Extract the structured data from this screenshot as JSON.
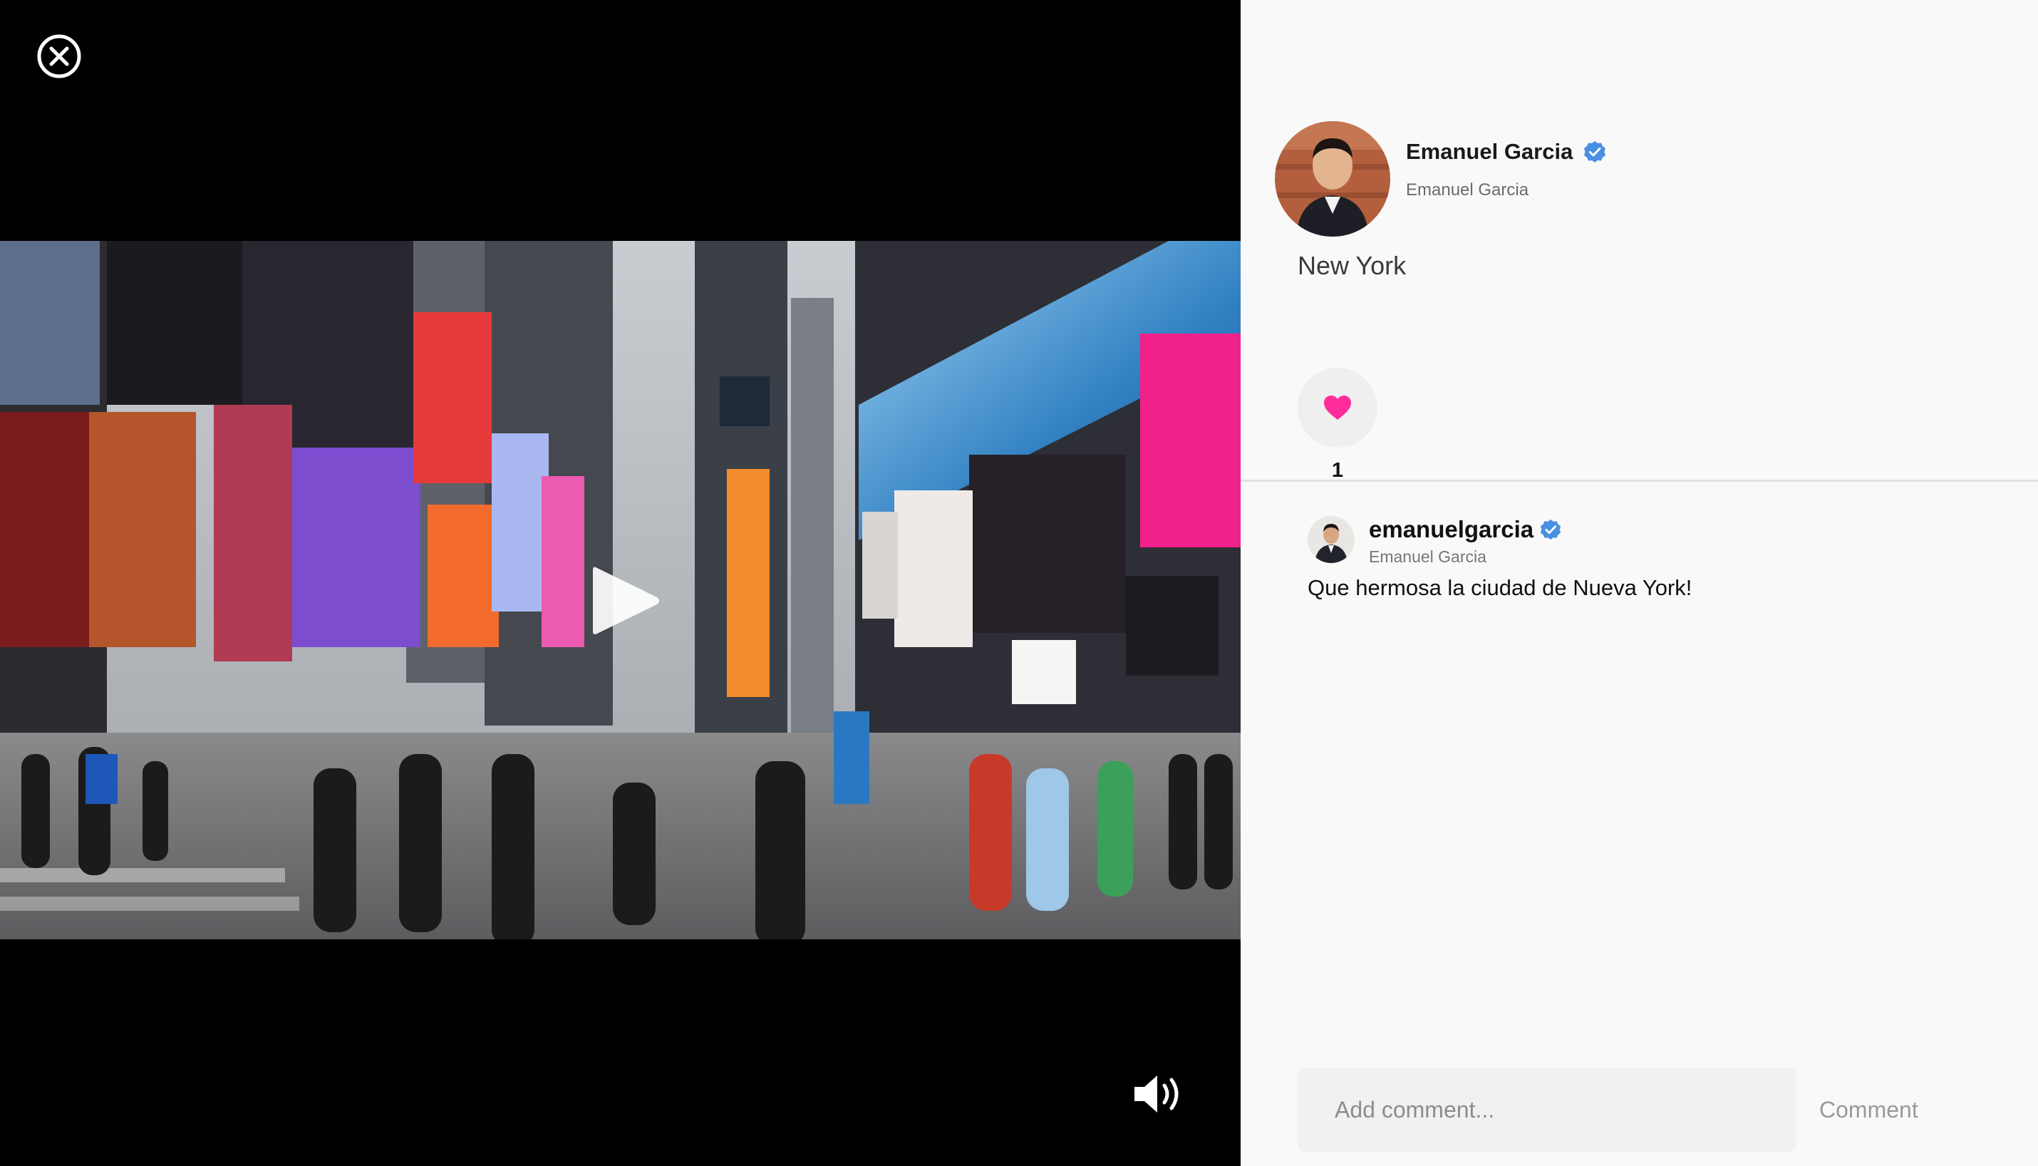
{
  "viewer": {
    "close_icon": "close-circle-icon",
    "play_icon": "play-icon",
    "volume_icon": "volume-up-icon"
  },
  "post": {
    "author_name": "Emanuel Garcia",
    "author_subtitle": "Emanuel Garcia",
    "verified": true,
    "location": "New York",
    "likes_count": "1",
    "like_icon": "heart-icon"
  },
  "comments": [
    {
      "username": "emanuelgarcia",
      "display_name": "Emanuel Garcia",
      "verified": true,
      "text": "Que hermosa la ciudad de Nueva York!"
    }
  ],
  "composer": {
    "placeholder": "Add comment...",
    "submit_label": "Comment"
  },
  "colors": {
    "accent_heart": "#ff2d9b",
    "verified_blue": "#4a90e2",
    "panel_bg": "#f9f9f9"
  }
}
